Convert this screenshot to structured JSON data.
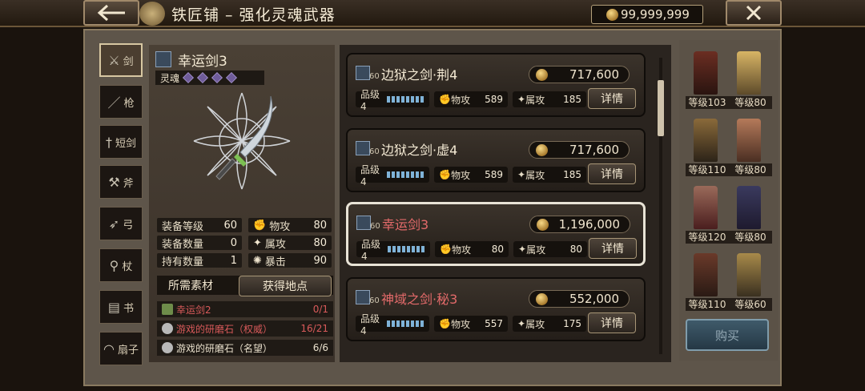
{
  "header": {
    "title": "铁匠铺 – 强化灵魂武器",
    "gold": "99,999,999"
  },
  "tabs": [
    {
      "label": "剑",
      "icon": "sword-icon"
    },
    {
      "label": "枪",
      "icon": "spear-icon"
    },
    {
      "label": "短剑",
      "icon": "dagger-icon"
    },
    {
      "label": "斧",
      "icon": "axe-icon"
    },
    {
      "label": "弓",
      "icon": "bow-icon"
    },
    {
      "label": "杖",
      "icon": "staff-icon"
    },
    {
      "label": "书",
      "icon": "book-icon"
    },
    {
      "label": "扇子",
      "icon": "fan-icon"
    }
  ],
  "selected_weapon": {
    "name": "幸运剑3",
    "soul_label": "灵魂",
    "stats": [
      {
        "label": "装备等级",
        "value": "60"
      },
      {
        "label": "装备数量",
        "value": "0"
      },
      {
        "label": "持有数量",
        "value": "1"
      },
      {
        "label": "物攻",
        "value": "80"
      },
      {
        "label": "属攻",
        "value": "80"
      },
      {
        "label": "暴击",
        "value": "90"
      }
    ],
    "materials_label": "所需素材",
    "location_button": "获得地点",
    "materials": [
      {
        "name": "幸运剑2",
        "count": "0/1"
      },
      {
        "name": "游戏的研磨石（权威）",
        "count": "16/21"
      },
      {
        "name": "游戏的研磨石（名望）",
        "count": "6/6"
      }
    ]
  },
  "list": [
    {
      "level": "60",
      "name": "边狱之剑·荆4",
      "price": "717,600",
      "grade": "品级4",
      "patk_label": "物攻",
      "patk": "589",
      "eatk_label": "属攻",
      "eatk": "185",
      "detail": "详情"
    },
    {
      "level": "60",
      "name": "边狱之剑·虚4",
      "price": "717,600",
      "grade": "品级4",
      "patk_label": "物攻",
      "patk": "589",
      "eatk_label": "属攻",
      "eatk": "185",
      "detail": "详情"
    },
    {
      "level": "60",
      "name": "幸运剑3",
      "price": "1,196,000",
      "grade": "品级4",
      "patk_label": "物攻",
      "patk": "80",
      "eatk_label": "属攻",
      "eatk": "80",
      "detail": "详情"
    },
    {
      "level": "60",
      "name": "神域之剑·秘3",
      "price": "552,000",
      "grade": "品级4",
      "patk_label": "物攻",
      "patk": "557",
      "eatk_label": "属攻",
      "eatk": "175",
      "detail": "详情"
    }
  ],
  "characters": [
    {
      "level": "等级103"
    },
    {
      "level": "等级80"
    },
    {
      "level": "等级110"
    },
    {
      "level": "等级80"
    },
    {
      "level": "等级120"
    },
    {
      "level": "等级80"
    },
    {
      "level": "等级110"
    },
    {
      "level": "等级60"
    }
  ],
  "buy_button": "购买"
}
